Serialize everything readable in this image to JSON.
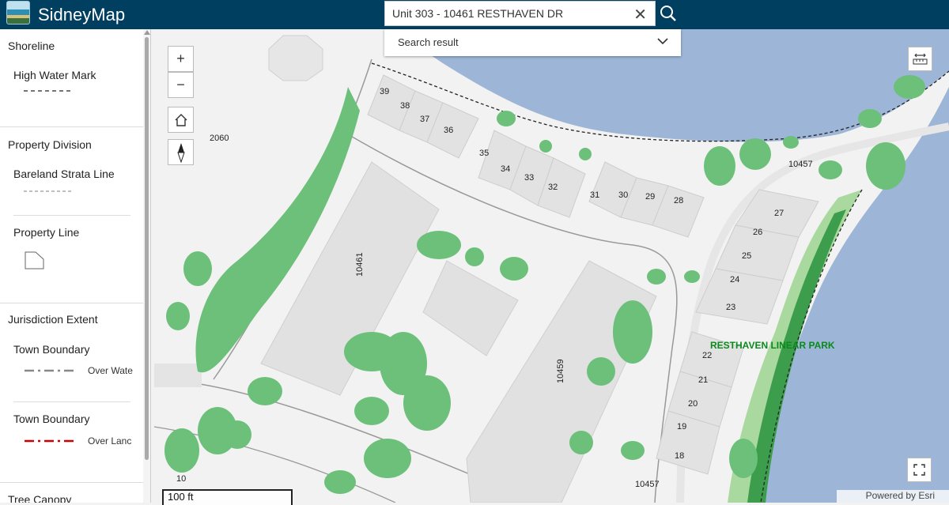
{
  "header": {
    "app_title": "SidneyMap"
  },
  "search": {
    "value": "Unit 303 - 10461 RESTHAVEN DR",
    "result_label": "Search result"
  },
  "legend": {
    "shoreline": {
      "title": "Shoreline",
      "item": "High Water Mark"
    },
    "property": {
      "title": "Property Division",
      "item1": "Bareland Strata Line",
      "item2": "Property Line"
    },
    "jurisdiction": {
      "title": "Jurisdiction Extent",
      "item1": "Town Boundary",
      "note1": "Over Wate",
      "item2": "Town Boundary",
      "note2": "Over Lanc"
    },
    "tree": {
      "title": "Tree Canopy"
    }
  },
  "controls": {
    "zoom_in": "+",
    "zoom_out": "−"
  },
  "map": {
    "unit_labels": [
      "39",
      "38",
      "37",
      "36",
      "35",
      "34",
      "33",
      "32",
      "31",
      "30",
      "29",
      "28",
      "27",
      "26",
      "25",
      "24",
      "23",
      "22",
      "21",
      "20",
      "19",
      "18"
    ],
    "lot_labels": [
      "2060",
      "10461",
      "10459",
      "10457",
      "10457",
      "10"
    ],
    "park_label": "RESTHAVEN LINEAR PARK",
    "scale": "100 ft",
    "attribution": "Powered by Esri"
  },
  "colors": {
    "header": "#003f60",
    "water": "#9db5d6",
    "tree": "#6cc07a",
    "park": "#3c9e4c",
    "building": "#e1e1e1"
  }
}
